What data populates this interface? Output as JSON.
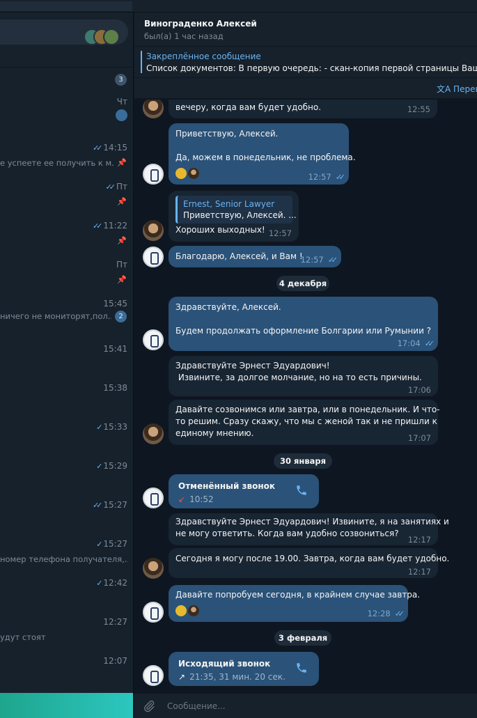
{
  "sidebar": {
    "rows": [
      {
        "time": "",
        "preview": "",
        "badge": "3"
      },
      {
        "time": "Чт",
        "preview": "",
        "badge": ""
      },
      {
        "time": "14:15",
        "preview": "е успеете ее получить к м...",
        "badge": ""
      },
      {
        "time": "Пт",
        "preview": "",
        "badge": ""
      },
      {
        "time": "11:22",
        "preview": "",
        "badge": ""
      },
      {
        "time": "Пт",
        "preview": "",
        "badge": ""
      },
      {
        "time": "15:45",
        "preview": "ничего не мониторят,пол...",
        "badge": "2"
      },
      {
        "time": "15:41",
        "preview": "",
        "badge": ""
      },
      {
        "time": "15:38",
        "preview": "",
        "badge": ""
      },
      {
        "time": "15:33",
        "preview": "",
        "badge": ""
      },
      {
        "time": "15:29",
        "preview": "",
        "badge": ""
      },
      {
        "time": "15:27",
        "preview": "",
        "badge": ""
      },
      {
        "time": "15:27",
        "preview": "номер телефона получателя,...",
        "badge": ""
      },
      {
        "time": "12:42",
        "preview": "",
        "badge": ""
      },
      {
        "time": "12:27",
        "preview": "удут стоят",
        "badge": ""
      },
      {
        "time": "12:07",
        "preview": "",
        "badge": ""
      }
    ]
  },
  "header": {
    "name": "Винограденко Алексей",
    "status": "был(а) 1 час назад"
  },
  "pinned": {
    "title": "Закреплённое сообщение",
    "text": "Список документов:   В первую очередь:  - скан-копия первой страницы Вашего"
  },
  "translate": {
    "label": "Перевести"
  },
  "messages": {
    "m1": {
      "text": "вечеру, когда вам будет удобно.",
      "time": "12:55"
    },
    "m2": {
      "text": "Приветствую, Алексей.\n\nДа, можем в понедельник, не проблема.",
      "time": "12:57"
    },
    "m3": {
      "reply_name": "Ernest, Senior Lawyer",
      "reply_text": "Приветствую, Алексей.  ...",
      "text": "Хороших выходных!",
      "time": "12:57"
    },
    "m4": {
      "text": "Благодарю, Алексей, и Вам !",
      "time": "12:57"
    },
    "date1": "4 декабря",
    "m5": {
      "text": "Здравствуйте, Алексей.\n\nБудем продолжать оформление Болгарии или Румынии ?",
      "time": "17:04"
    },
    "m6": {
      "text": "Здравствуйте Эрнест Эдуардович!\n Извините, за долгое молчание, но на то есть причины.",
      "time": "17:06"
    },
    "m7": {
      "text": "Давайте созвонимся или завтра, или в понедельник. И что-\nто решим. Сразу скажу, что мы с женой так и не пришли к\nединому мнению.",
      "time": "17:07"
    },
    "date2": "30 января",
    "call1": {
      "title": "Отменённый звонок",
      "sub": "10:52"
    },
    "m8": {
      "text": "Здравствуйте Эрнест Эдуардович! Извините, я на занятиях и\nне могу ответить. Когда вам удобно созвониться?",
      "time": "12:17"
    },
    "m9": {
      "text": "Сегодня я могу после 19.00. Завтра, когда вам будет удобно.",
      "time": "12:17"
    },
    "m10": {
      "text": "Давайте попробуем сегодня, в крайнем случае завтра.",
      "time": "12:28"
    },
    "date3": "3 февраля",
    "call2": {
      "title": "Исходящий звонок",
      "sub": "21:35, 31 мин. 20 сек."
    }
  },
  "composer": {
    "placeholder": "Сообщение..."
  },
  "colors": {
    "accent": "#6ab3f3",
    "outgoing_bubble": "#2b5278",
    "incoming_bubble": "#182533",
    "background": "#0e1621",
    "missed_call": "#e5564b"
  }
}
